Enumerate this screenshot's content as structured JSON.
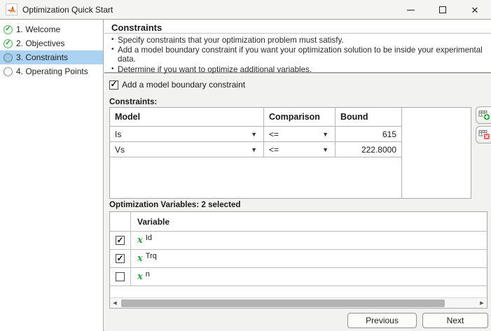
{
  "window": {
    "title": "Optimization Quick Start"
  },
  "icons": {
    "close": "✕",
    "dropdown": "▼",
    "check": "✓",
    "scroll_left": "◀",
    "scroll_right": "▶",
    "variable_x": "x"
  },
  "sidebar": {
    "items": [
      {
        "label": "1. Welcome",
        "state": "complete",
        "check": "✓"
      },
      {
        "label": "2. Objectives",
        "state": "complete",
        "check": "✓"
      },
      {
        "label": "3. Constraints",
        "state": "active",
        "check": ""
      },
      {
        "label": "4. Operating Points",
        "state": "pending",
        "check": ""
      }
    ]
  },
  "main": {
    "heading": "Constraints",
    "bullets": [
      "Specify constraints that your optimization problem must satisfy.",
      "Add a model boundary constraint if you want your optimization solution to be inside your experimental data.",
      "Determine if you want to optimize additional variables."
    ],
    "boundary_checkbox": {
      "label": "Add a model boundary constraint",
      "check": "✓"
    },
    "constraints": {
      "label": "Constraints:",
      "columns": {
        "model": "Model",
        "comparison": "Comparison",
        "bound": "Bound"
      },
      "rows": [
        {
          "model": "Is",
          "comparison": "<=",
          "bound": "615"
        },
        {
          "model": "Vs",
          "comparison": "<=",
          "bound": "222.8000"
        }
      ]
    },
    "variables": {
      "label": "Optimization Variables: 2 selected",
      "column_header": "Variable",
      "rows": [
        {
          "name": "Id",
          "check": "✓"
        },
        {
          "name": "Trq",
          "check": "✓"
        },
        {
          "name": "n",
          "check": ""
        }
      ]
    },
    "footer": {
      "previous": "Previous",
      "next": "Next"
    }
  },
  "colors": {
    "selection_blue": "#abd3f1",
    "complete_green": "#54b257",
    "variable_green": "#2e9e3e",
    "add_badge_green": "#35a83f",
    "delete_badge_red": "#e34f4f",
    "section_gray": "#f2f2f0",
    "border_gray": "#a9a9a9"
  }
}
